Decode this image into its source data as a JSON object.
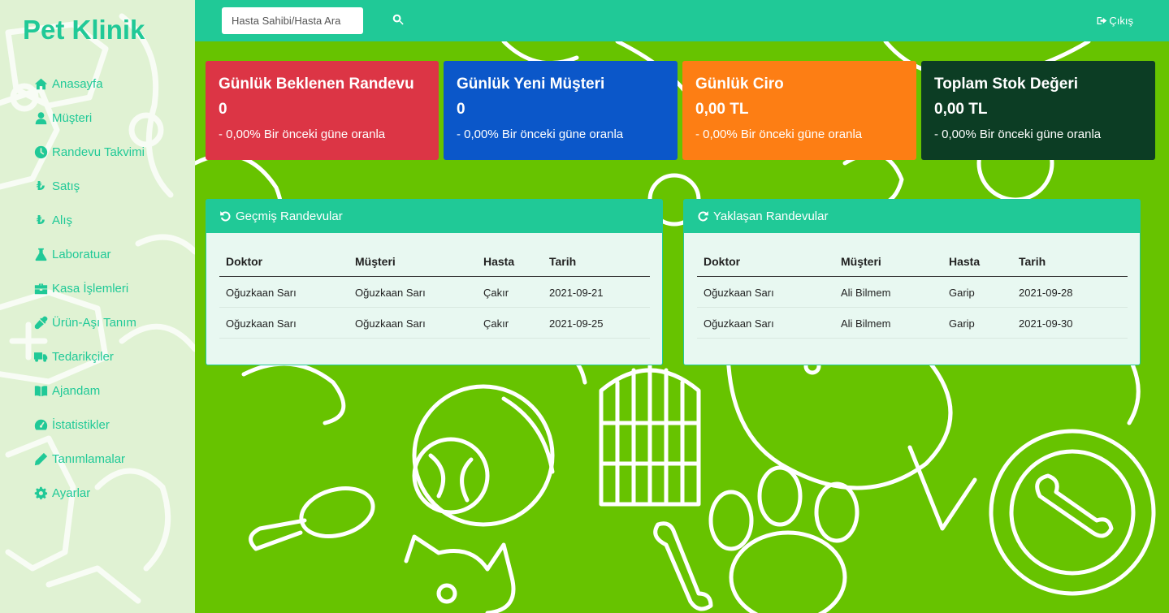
{
  "brand": "Pet Klinik",
  "nav": [
    {
      "label": "Anasayfa",
      "icon": "home-icon"
    },
    {
      "label": "Müşteri",
      "icon": "user-icon"
    },
    {
      "label": "Randevu Takvimi",
      "icon": "clock-icon"
    },
    {
      "label": "Satış",
      "icon": "lira-icon"
    },
    {
      "label": "Alış",
      "icon": "lira-icon"
    },
    {
      "label": "Laboratuar",
      "icon": "flask-icon"
    },
    {
      "label": "Kasa İşlemleri",
      "icon": "briefcase-icon"
    },
    {
      "label": "Ürün-Aşı Tanım",
      "icon": "eyedropper-icon"
    },
    {
      "label": "Tedarikçiler",
      "icon": "truck-icon"
    },
    {
      "label": "Ajandam",
      "icon": "book-icon"
    },
    {
      "label": "İstatistikler",
      "icon": "dashboard-icon"
    },
    {
      "label": "Tanımlamalar",
      "icon": "pencil-icon"
    },
    {
      "label": "Ayarlar",
      "icon": "gear-icon"
    }
  ],
  "topbar": {
    "search_placeholder": "Hasta Sahibi/Hasta Ara",
    "logout_label": "Çıkış"
  },
  "cards": [
    {
      "title": "Günlük Beklenen Randevu",
      "value": "0",
      "sub": "- 0,00% Bir önceki güne oranla",
      "color": "#dc3545"
    },
    {
      "title": "Günlük Yeni Müşteri",
      "value": "0",
      "sub": "- 0,00% Bir önceki güne oranla",
      "color": "#0b57c9"
    },
    {
      "title": "Günlük Ciro",
      "value": "0,00 TL",
      "sub": "- 0,00% Bir önceki güne oranla",
      "color": "#fd7e14"
    },
    {
      "title": "Toplam Stok Değeri",
      "value": "0,00 TL",
      "sub": "- 0,00% Bir önceki güne oranla",
      "color": "#0c3d24"
    }
  ],
  "past_panel": {
    "title": "Geçmiş Randevular",
    "headers": [
      "Doktor",
      "Müşteri",
      "Hasta",
      "Tarih"
    ],
    "rows": [
      [
        "Oğuzkaan Sarı",
        "Oğuzkaan Sarı",
        "Çakır",
        "2021-09-21"
      ],
      [
        "Oğuzkaan Sarı",
        "Oğuzkaan Sarı",
        "Çakır",
        "2021-09-25"
      ]
    ]
  },
  "upcoming_panel": {
    "title": "Yaklaşan Randevular",
    "headers": [
      "Doktor",
      "Müşteri",
      "Hasta",
      "Tarih"
    ],
    "rows": [
      [
        "Oğuzkaan Sarı",
        "Ali Bilmem",
        "Garip",
        "2021-09-28"
      ],
      [
        "Oğuzkaan Sarı",
        "Ali Bilmem",
        "Garip",
        "2021-09-30"
      ]
    ]
  }
}
